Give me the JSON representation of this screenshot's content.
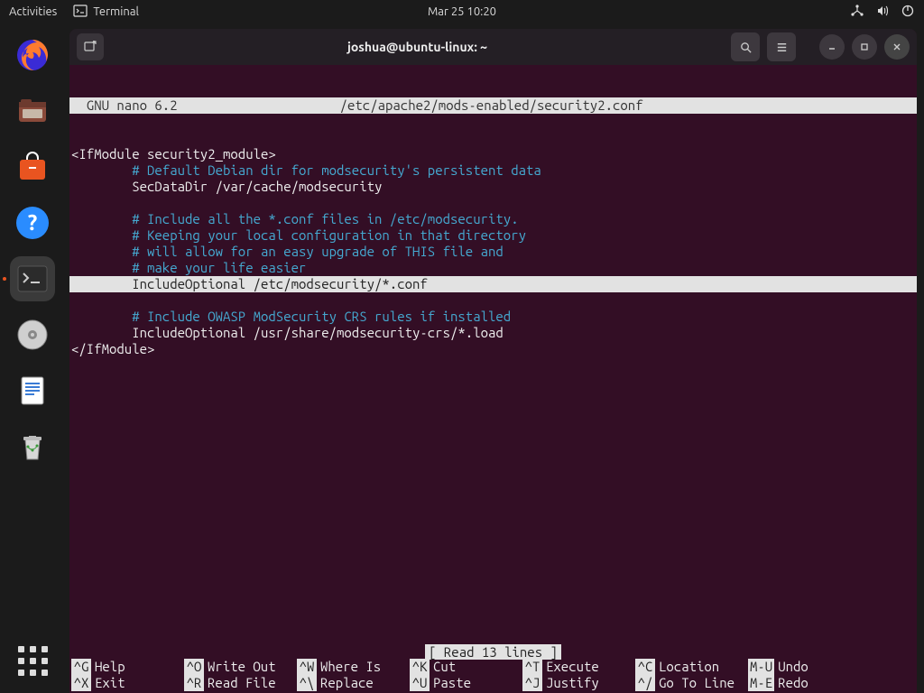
{
  "topbar": {
    "activities": "Activities",
    "app_name": "Terminal",
    "clock": "Mar 25  10:20"
  },
  "dock_items": [
    {
      "name": "firefox",
      "bg": "linear-gradient(#ff7b2e,#e03b10)",
      "glyph": "firefox"
    },
    {
      "name": "files",
      "bg": "#8a4a3a",
      "glyph": "files"
    },
    {
      "name": "software",
      "bg": "#e95420",
      "glyph": "bag"
    },
    {
      "name": "help",
      "bg": "#2a8cff",
      "glyph": "?"
    },
    {
      "name": "terminal",
      "bg": "#2b2b2b",
      "glyph": ">_",
      "active": true
    },
    {
      "name": "disk",
      "bg": "#cfcfcf",
      "glyph": "disc"
    },
    {
      "name": "text-editor",
      "bg": "#e8e8e8",
      "glyph": "doc"
    },
    {
      "name": "trash",
      "bg": "#d7d7d7",
      "glyph": "trash"
    }
  ],
  "window": {
    "title": "joshua@ubuntu-linux: ~"
  },
  "nano": {
    "app": "  GNU nano 6.2",
    "file": "/etc/apache2/mods-enabled/security2.conf",
    "status": "[ Read 13 lines ]",
    "lines": [
      {
        "t": "<IfModule security2_module>",
        "cls": ""
      },
      {
        "t": "        # Default Debian dir for modsecurity's persistent data",
        "cls": "comment"
      },
      {
        "t": "        SecDataDir /var/cache/modsecurity",
        "cls": ""
      },
      {
        "t": "",
        "cls": ""
      },
      {
        "t": "        # Include all the *.conf files in /etc/modsecurity.",
        "cls": "comment"
      },
      {
        "t": "        # Keeping your local configuration in that directory",
        "cls": "comment"
      },
      {
        "t": "        # will allow for an easy upgrade of THIS file and",
        "cls": "comment"
      },
      {
        "t": "        # make your life easier",
        "cls": "comment"
      },
      {
        "t": "        IncludeOptional /etc/modsecurity/*.conf",
        "cls": "hl"
      },
      {
        "t": "",
        "cls": ""
      },
      {
        "t": "        # Include OWASP ModSecurity CRS rules if installed",
        "cls": "comment"
      },
      {
        "t": "        IncludeOptional /usr/share/modsecurity-crs/*.load",
        "cls": ""
      },
      {
        "t": "</IfModule>",
        "cls": ""
      }
    ],
    "shortcuts": [
      [
        {
          "k": "^G",
          "l": "Help"
        },
        {
          "k": "^O",
          "l": "Write Out"
        },
        {
          "k": "^W",
          "l": "Where Is"
        },
        {
          "k": "^K",
          "l": "Cut"
        },
        {
          "k": "^T",
          "l": "Execute"
        },
        {
          "k": "^C",
          "l": "Location"
        },
        {
          "k": "M-U",
          "l": "Undo",
          "narrow": true
        }
      ],
      [
        {
          "k": "^X",
          "l": "Exit"
        },
        {
          "k": "^R",
          "l": "Read File"
        },
        {
          "k": "^\\",
          "l": "Replace"
        },
        {
          "k": "^U",
          "l": "Paste"
        },
        {
          "k": "^J",
          "l": "Justify"
        },
        {
          "k": "^/",
          "l": "Go To Line"
        },
        {
          "k": "M-E",
          "l": "Redo",
          "narrow": true
        }
      ]
    ]
  }
}
